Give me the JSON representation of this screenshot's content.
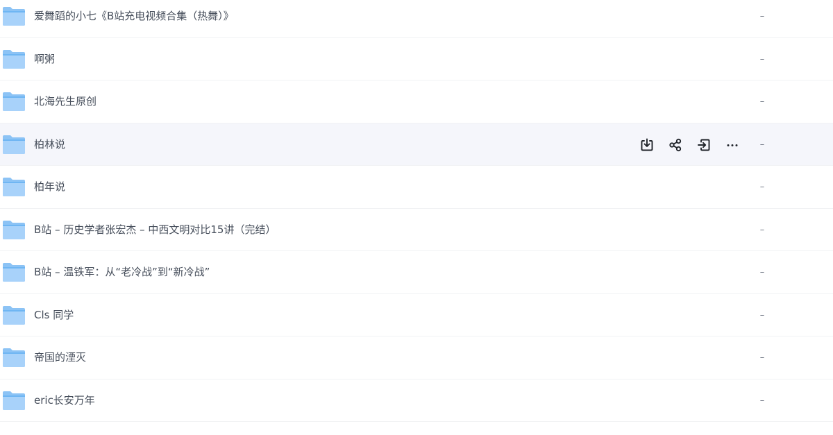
{
  "folders": [
    {
      "name": "爱舞蹈的小七《B站充电视频合集（热舞）》",
      "size": "–"
    },
    {
      "name": "啊粥",
      "size": "–"
    },
    {
      "name": "北海先生原创",
      "size": "–"
    },
    {
      "name": "柏林说",
      "size": "–"
    },
    {
      "name": "柏年说",
      "size": "–"
    },
    {
      "name": "B站 – 历史学者张宏杰 – 中西文明对比15讲（完结）",
      "size": "–"
    },
    {
      "name": "B站 – 温铁军：从“老冷战”到“新冷战”",
      "size": "–"
    },
    {
      "name": "Cls 同学",
      "size": "–"
    },
    {
      "name": "帝国的湮灭",
      "size": "–"
    },
    {
      "name": "eric长安万年",
      "size": "–"
    }
  ],
  "hover_row_actions": [
    "download-icon",
    "share-icon",
    "move-icon",
    "more-icon"
  ],
  "colors": {
    "folder_light": "#a8d2fa",
    "folder_dark": "#5aa9ef",
    "hover_bg": "#f5f6fb",
    "text": "#454d5a"
  }
}
